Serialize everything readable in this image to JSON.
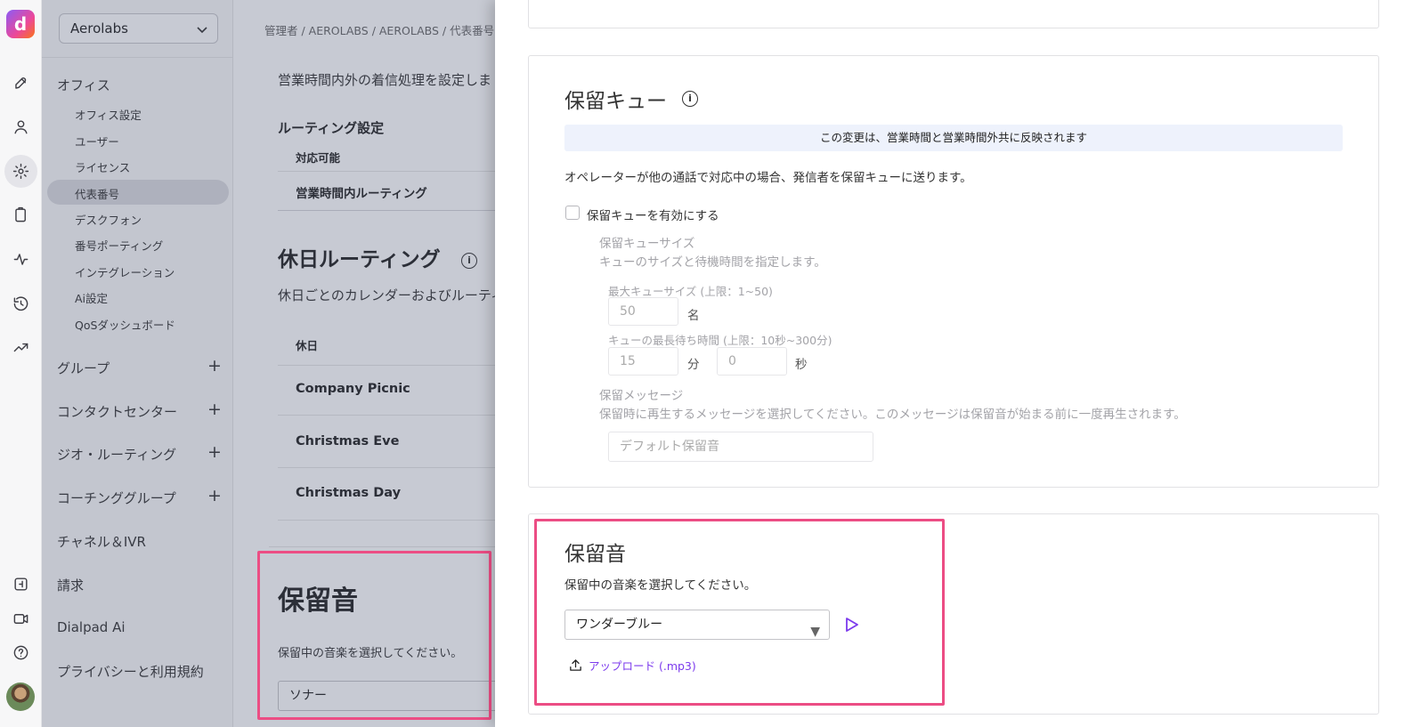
{
  "rail": {
    "items": [
      "launch-icon",
      "person-icon",
      "gear-icon",
      "contacts-icon",
      "activity-icon",
      "history-icon",
      "trending-icon"
    ],
    "bottom": [
      "dialpad-icon",
      "video-icon",
      "help-icon"
    ]
  },
  "sidebar": {
    "org": "Aerolabs",
    "office_section": "オフィス",
    "office_items": [
      "オフィス設定",
      "ユーザー",
      "ライセンス",
      "代表番号",
      "デスクフォン",
      "番号ポーティング",
      "インテグレーション",
      "Ai設定",
      "QoSダッシュボード"
    ],
    "groups": [
      "グループ",
      "コンタクトセンター",
      "ジオ・ルーティング",
      "コーチンググループ"
    ],
    "plus": "+",
    "other": [
      "チャネル＆IVR",
      "請求",
      "Dialpad Ai",
      "プライバシーと利用規約"
    ]
  },
  "background": {
    "breadcrumb": "管理者 / AEROLABS / AEROLABS / 代表番号",
    "desc_top": "営業時間内外の着信処理を設定しま",
    "routing_label": "ルーティング設定",
    "available_label": "対応可能",
    "business_routing": "営業時間内ルーティング",
    "holiday_title": "休日ルーティング",
    "holiday_desc": "休日ごとのカレンダーおよびルーティ",
    "holiday_col": "休日",
    "holidays": [
      "Company Picnic",
      "Christmas Eve",
      "Christmas Day"
    ],
    "hold_music_title": "保留音",
    "hold_music_desc": "保留中の音楽を選択してください。",
    "hold_music_value": "ソナー"
  },
  "queue": {
    "title": "保留キュー",
    "info": "i",
    "banner": "この変更は、営業時間と営業時間外共に反映されます",
    "desc": "オペレーターが他の通話で対応中の場合、発信者を保留キューに送ります。",
    "enable_label": "保留キューを有効にする",
    "size_title": "保留キューサイズ",
    "size_desc": "キューのサイズと待機時間を指定します。",
    "max_size_label": "最大キューサイズ (上限：1~50)",
    "max_size_value": "50",
    "max_size_unit": "名",
    "max_wait_label": "キューの最長待ち時間 (上限：10秒~300分)",
    "wait_min_value": "15",
    "wait_min_unit": "分",
    "wait_sec_value": "0",
    "wait_sec_unit": "秒",
    "message_title": "保留メッセージ",
    "message_desc": "保留時に再生するメッセージを選択してください。このメッセージは保留音が始まる前に一度再生されます。",
    "message_placeholder": "デフォルト保留音"
  },
  "hold_music": {
    "title": "保留音",
    "desc": "保留中の音楽を選択してください。",
    "selected": "ワンダーブルー",
    "upload": "アップロード (.mp3)"
  },
  "colors": {
    "highlight": "#ec4d84",
    "accent": "#7c3aed"
  }
}
